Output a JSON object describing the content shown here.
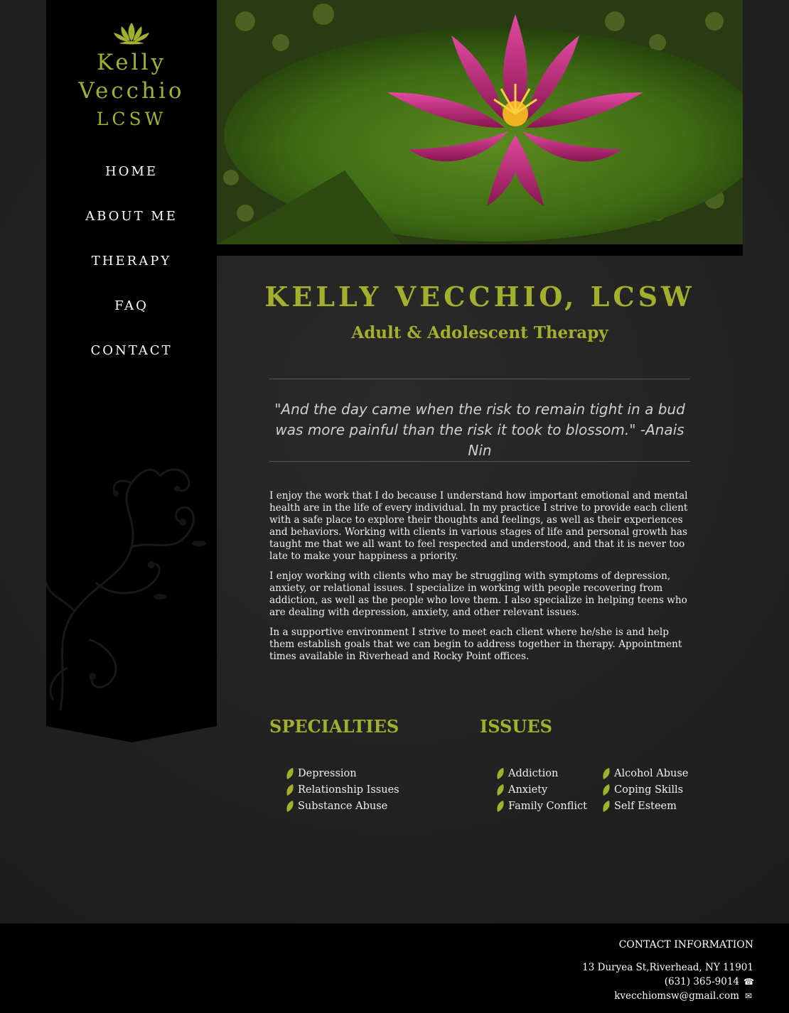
{
  "brand": {
    "line1": "Kelly",
    "line2": "Vecchio",
    "line3": "LCSW",
    "color": "#a3b02d",
    "icon": "lotus-icon"
  },
  "nav": {
    "items": [
      {
        "label": "HOME"
      },
      {
        "label": "ABOUT ME"
      },
      {
        "label": "THERAPY"
      },
      {
        "label": "FAQ"
      },
      {
        "label": "CONTACT"
      }
    ]
  },
  "main": {
    "title": "KELLY VECCHIO, LCSW",
    "subtitle": "Adult & Adolescent Therapy",
    "quote": "\"And the day came when the risk to remain tight in a bud was more painful than the risk it took to blossom.\" -Anais Nin",
    "paragraphs": [
      "I enjoy the work that I do because I understand how important emotional and mental health are in the life of every individual. In my practice I strive to provide each client with a safe place to explore their thoughts and feelings, as well as their experiences and behaviors. Working with clients in various stages of life and personal growth has taught me that we all want to feel respected and understood, and that it is never too late to make your happiness a priority.",
      "I enjoy working with clients who may be struggling with symptoms of depression, anxiety, or relational issues. I specialize in working with people recovering from addiction, as well as the people who love them. I also specialize in helping teens who are dealing with depression, anxiety, and other relevant issues.",
      "In a supportive environment I strive to meet each client where he/she is and help them establish goals that we can begin to address together in therapy. Appointment times available in Riverhead and Rocky Point offices."
    ],
    "specialties": {
      "heading": "SPECIALTIES",
      "items": [
        "Depression",
        "Relationship Issues",
        "Substance Abuse"
      ]
    },
    "issues": {
      "heading": "ISSUES",
      "col1": [
        "Addiction",
        "Anxiety",
        "Family Conflict"
      ],
      "col2": [
        "Alcohol Abuse",
        "Coping Skills",
        "Self Esteem"
      ]
    }
  },
  "footer": {
    "heading": "CONTACT INFORMATION",
    "address": "13 Duryea St,Riverhead, NY 11901",
    "phone": "(631) 365-9014",
    "email": "kvecchiomsw@gmail.com",
    "phone_icon": "phone-icon",
    "email_icon": "envelope-icon"
  }
}
